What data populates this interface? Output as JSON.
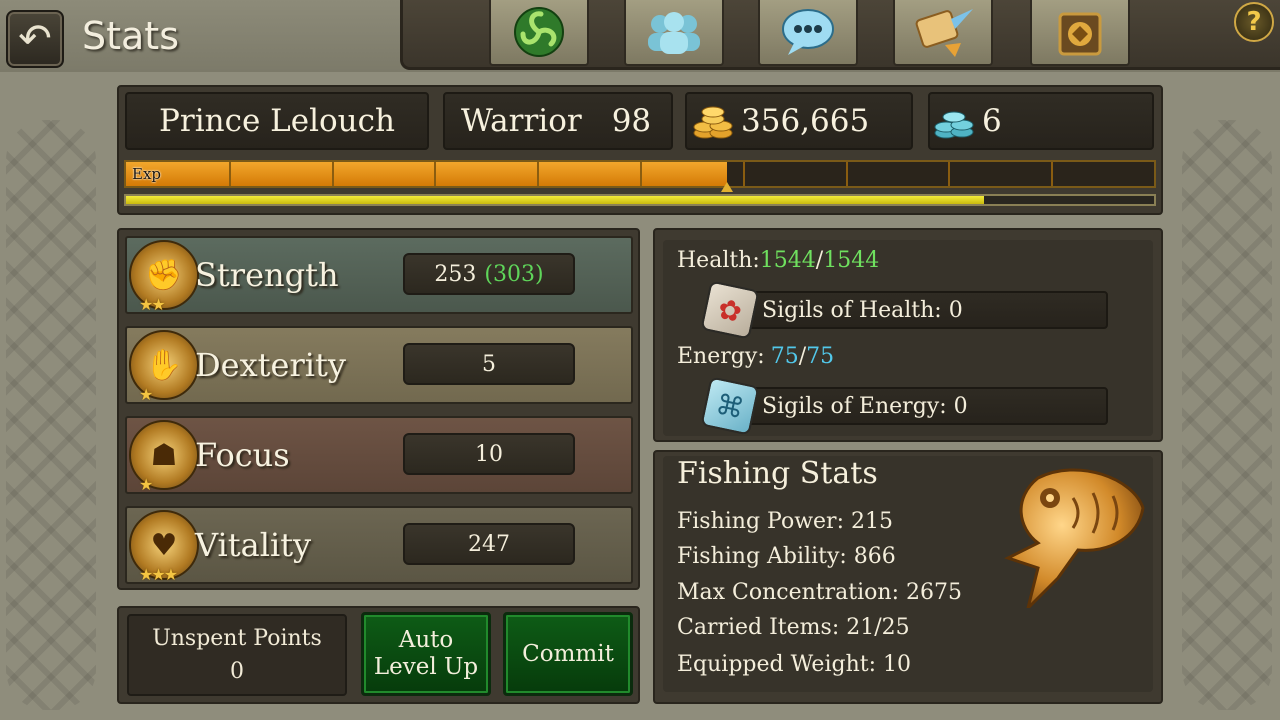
{
  "header": {
    "title": "Stats",
    "back_icon": "back-arrow-icon",
    "nav_icons": [
      "triskele-icon",
      "friends-icon",
      "chat-icon",
      "quest-scroll-icon",
      "guild-crest-icon"
    ],
    "help_label": "?"
  },
  "player": {
    "name": "Prince Lelouch",
    "class": "Warrior",
    "level": "98",
    "gold": "356,665",
    "gems": "6"
  },
  "exp": {
    "label": "Exp",
    "fill_fraction": 0.585,
    "secondary_fraction": 0.835,
    "segments": 10
  },
  "stats": [
    {
      "name": "Strength",
      "value": "253",
      "bonus": "(303)",
      "icon": "strength-fist-icon",
      "stars": "★★"
    },
    {
      "name": "Dexterity",
      "value": "5",
      "bonus": "",
      "icon": "dexterity-gauntlet-icon",
      "stars": "★"
    },
    {
      "name": "Focus",
      "value": "10",
      "bonus": "",
      "icon": "focus-helmet-icon",
      "stars": "★"
    },
    {
      "name": "Vitality",
      "value": "247",
      "bonus": "",
      "icon": "vitality-heart-icon",
      "stars": "★★★"
    }
  ],
  "actions": {
    "unspent_label": "Unspent Points",
    "unspent_value": "0",
    "auto_level_up_line1": "Auto",
    "auto_level_up_line2": "Level Up",
    "commit": "Commit"
  },
  "vitals": {
    "health_label": "Health:",
    "health_current": "1544",
    "health_max": "1544",
    "sigils_health": "Sigils of Health: 0",
    "energy_label": "Energy:",
    "energy_current": "75",
    "energy_max": "75",
    "sigils_energy": "Sigils of Energy: 0",
    "slash": "/"
  },
  "fishing": {
    "title": "Fishing Stats",
    "lines": [
      "Fishing Power: 215",
      "Fishing Ability: 866",
      "Max Concentration: 2675",
      "Carried Items: 21/25",
      "Equipped Weight: 10"
    ],
    "emblem_icon": "golden-fish-icon"
  },
  "colors": {
    "exp_orange": "#e8911a",
    "health_green": "#6fe05f",
    "energy_cyan": "#52c8ea",
    "button_green": "#0e5c16"
  }
}
